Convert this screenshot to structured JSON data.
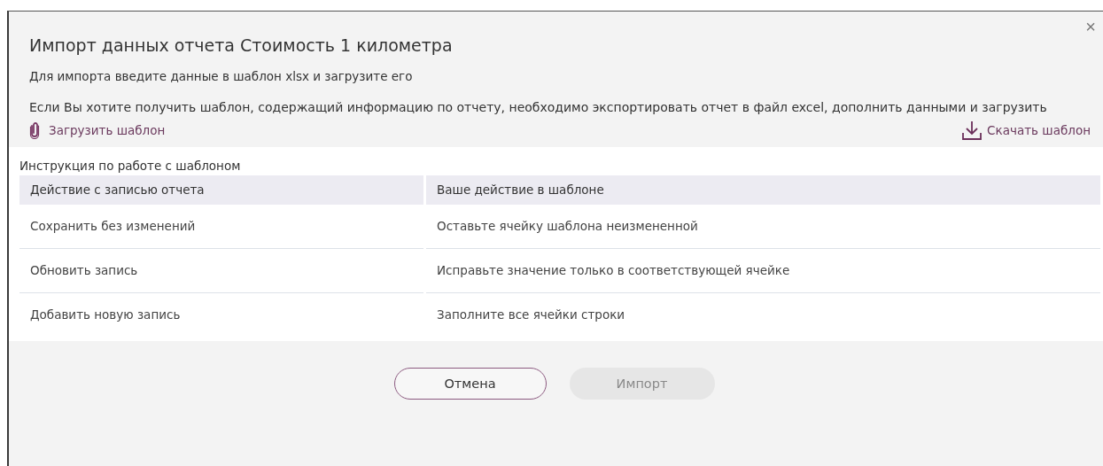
{
  "dialog": {
    "title": "Импорт данных отчета Стоимость 1 километра",
    "intro": "Для импорта введите данные в шаблон xlsx и загрузите его",
    "note": "Если Вы хотите получить шаблон, содержащий информацию по отчету, необходимо экспортировать отчет в файл excel, дополнить данными и загрузить",
    "close": "×"
  },
  "actions": {
    "upload": "Загрузить шаблон",
    "download": "Скачать шаблон"
  },
  "instruction": {
    "caption": "Инструкция по работе с шаблоном",
    "columns": [
      "Действие с записью отчета",
      "Ваше действие в шаблоне"
    ],
    "rows": [
      [
        "Сохранить без изменений",
        "Оставьте ячейку шаблона неизмененной"
      ],
      [
        "Обновить запись",
        "Исправьте значение только в соответствующей ячейке"
      ],
      [
        "Добавить новую запись",
        "Заполните все ячейки строки"
      ]
    ]
  },
  "buttons": [
    {
      "label": "Отмена",
      "kind": "outline",
      "disabled": false
    },
    {
      "label": "Импорт",
      "kind": "filled",
      "disabled": true
    }
  ]
}
